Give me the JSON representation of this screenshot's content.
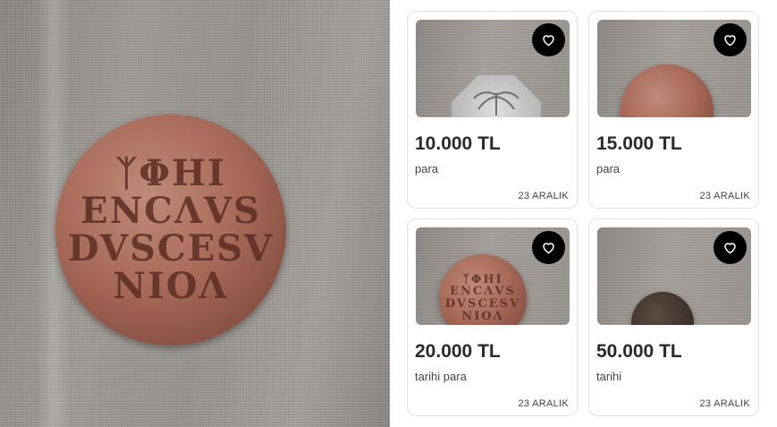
{
  "hero": {
    "coin_inscription": [
      "ᛉΦΗΙ",
      "ENCΛVS",
      "DVSCESV",
      "ΝΙΟΛ"
    ]
  },
  "listings": [
    {
      "price": "10.000 TL",
      "title": "para",
      "date": "23 ARALIK",
      "thumb": "silver-octagonal-coin-palm"
    },
    {
      "price": "15.000 TL",
      "title": "para",
      "date": "23 ARALIK",
      "thumb": "copper-coin"
    },
    {
      "price": "20.000 TL",
      "title": "tarihi para",
      "date": "23 ARALIK",
      "thumb": "copper-coin-inscribed"
    },
    {
      "price": "50.000 TL",
      "title": "tarihi",
      "date": "23 ARALIK",
      "thumb": "dark-bronze-coin"
    }
  ],
  "icons": {
    "favorite": "heart-outline-icon"
  },
  "colors": {
    "favorite_bg": "#000000",
    "price_text": "#2a2a2a",
    "card_border": "#e1e1e1"
  }
}
